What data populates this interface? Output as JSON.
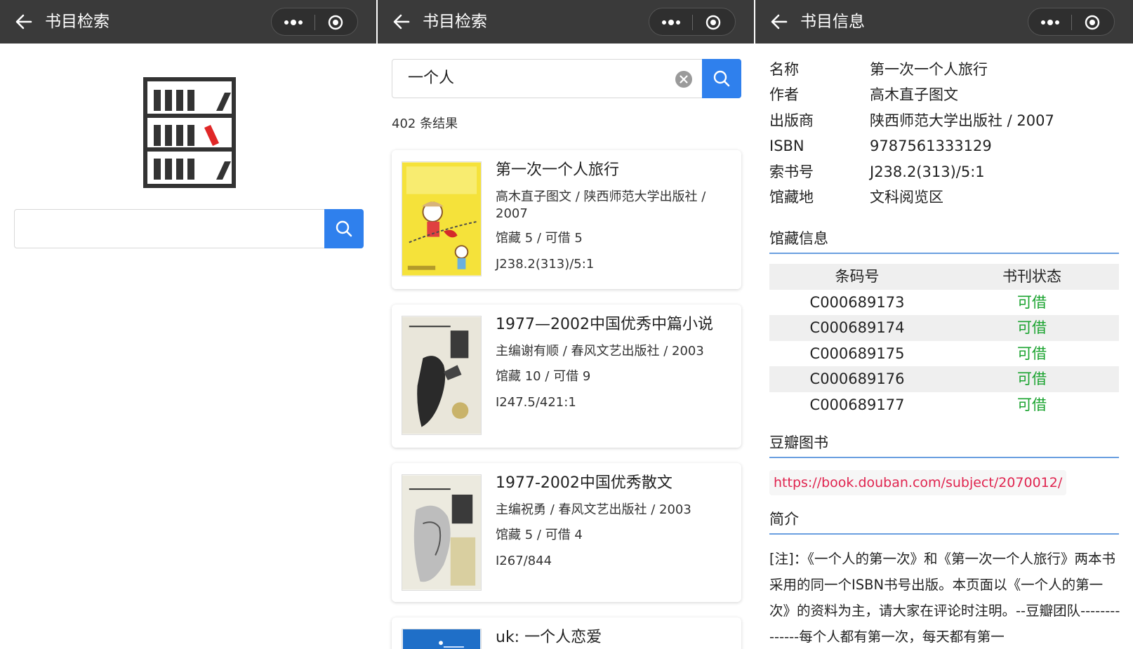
{
  "screen1": {
    "nav_title": "书目检索",
    "search": {
      "value": ""
    }
  },
  "screen2": {
    "nav_title": "书目检索",
    "search": {
      "value": "一个人"
    },
    "result_count": "402 条结果",
    "results": [
      {
        "title": "第一次一个人旅行",
        "author_pub": "高木直子图文 / 陕西师范大学出版社 / 2007",
        "holdings": "馆藏 5 / 可借 5",
        "call_no": "J238.2(313)/5:1"
      },
      {
        "title": "1977—2002中国优秀中篇小说",
        "author_pub": "主编谢有顺 / 春风文艺出版社 / 2003",
        "holdings": "馆藏 10 / 可借 9",
        "call_no": "I247.5/421:1"
      },
      {
        "title": "1977-2002中国优秀散文",
        "author_pub": "主编祝勇 / 春风文艺出版社 / 2003",
        "holdings": "馆藏 5 / 可借 4",
        "call_no": "I267/844"
      },
      {
        "title": "uk: 一个人恋爱"
      }
    ]
  },
  "screen3": {
    "nav_title": "书目信息",
    "fields": [
      {
        "key": "名称",
        "value": "第一次一个人旅行"
      },
      {
        "key": "作者",
        "value": "高木直子图文"
      },
      {
        "key": "出版商",
        "value": "陕西师范大学出版社 / 2007"
      },
      {
        "key": "ISBN",
        "value": "9787561333129"
      },
      {
        "key": "索书号",
        "value": "J238.2(313)/5:1"
      },
      {
        "key": "馆藏地",
        "value": "文科阅览区"
      }
    ],
    "holdings_title": "馆藏信息",
    "holdings_headers": [
      "条码号",
      "书刊状态"
    ],
    "holdings": [
      {
        "barcode": "C000689173",
        "status": "可借"
      },
      {
        "barcode": "C000689174",
        "status": "可借"
      },
      {
        "barcode": "C000689175",
        "status": "可借"
      },
      {
        "barcode": "C000689176",
        "status": "可借"
      },
      {
        "barcode": "C000689177",
        "status": "可借"
      }
    ],
    "douban_title": "豆瓣图书",
    "douban_link": "https://book.douban.com/subject/2070012/",
    "intro_title": "简介",
    "intro_text": "[注]：《一个人的第一次》和《第一次一个人旅行》两本书采用的同一个ISBN书号出版。本页面以《一个人的第一次》的资料为主，请大家在评论时注明。--豆瓣团队--------------每个人都有第一次，每天都有第一"
  },
  "colors": {
    "nav_bg": "#3a3a3a",
    "accent": "#2f80ed",
    "available": "#1aa32f",
    "link": "#e0244f",
    "section_line": "#6a9fe0"
  },
  "icons": [
    "back-arrow-icon",
    "more-dots-icon",
    "record-circle-icon",
    "search-icon",
    "clear-icon",
    "bookshelf-logo-icon"
  ]
}
